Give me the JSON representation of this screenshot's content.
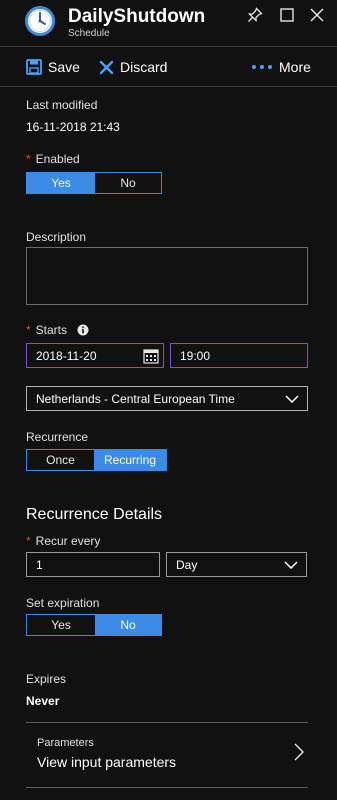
{
  "header": {
    "title": "DailyShutdown",
    "subtitle": "Schedule"
  },
  "toolbar": {
    "save_label": "Save",
    "discard_label": "Discard",
    "more_label": "More"
  },
  "last_modified": {
    "label": "Last modified",
    "value": "16-11-2018 21:43"
  },
  "enabled": {
    "label": "Enabled",
    "yes_label": "Yes",
    "no_label": "No",
    "selected": "Yes"
  },
  "description": {
    "label": "Description",
    "value": ""
  },
  "starts": {
    "label": "Starts",
    "date": "2018-11-20",
    "time": "19:00"
  },
  "timezone": {
    "value": "Netherlands - Central European Time"
  },
  "recurrence": {
    "label": "Recurrence",
    "once_label": "Once",
    "recurring_label": "Recurring",
    "selected": "Recurring"
  },
  "recurrence_details": {
    "title": "Recurrence Details",
    "recur_every_label": "Recur every",
    "interval": "1",
    "unit": "Day"
  },
  "expiration": {
    "label": "Set expiration",
    "yes_label": "Yes",
    "no_label": "No",
    "selected": "No"
  },
  "expires": {
    "label": "Expires",
    "value": "Never"
  },
  "parameters": {
    "label": "Parameters",
    "link": "View input parameters"
  },
  "colors": {
    "accent": "#3c8ce7",
    "required": "#e8473d",
    "focus_border": "#8e4bd4",
    "background": "#111111"
  }
}
